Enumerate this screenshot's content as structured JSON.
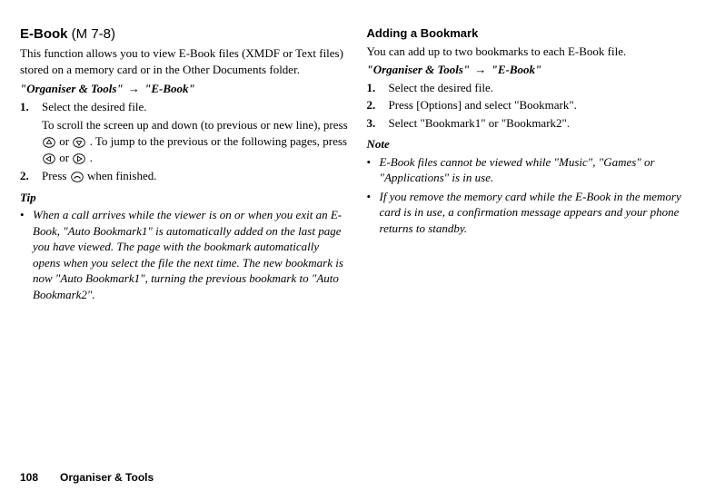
{
  "left": {
    "title_main": "E-Book ",
    "title_paren_open": "(",
    "title_menu_glyph": "M",
    "title_menu_num": " 7-8)",
    "intro": "This function allows you to view E-Book files (XMDF or Text files) stored on a memory card or in the Other Documents folder.",
    "path_a": "\"Organiser & Tools\"",
    "path_b": "\"E-Book\"",
    "step1_num": "1.",
    "step1_text": "Select the desired file.",
    "step1_sub_a": "To scroll the screen up and down (to previous or new line), press ",
    "step1_sub_b": " or ",
    "step1_sub_c": ". To jump to the previous or the following pages, press ",
    "step1_sub_d": " or ",
    "step1_sub_e": ".",
    "step2_num": "2.",
    "step2_a": "Press ",
    "step2_b": " when finished.",
    "tip_label": "Tip",
    "tip_bullet": "When a call arrives while the viewer is on or when you exit an E-Book, \"Auto Bookmark1\" is automatically added on the last page you have viewed. The page with the bookmark automatically opens when you select the file the next time. The new bookmark is now \"Auto Bookmark1\", turning the previous bookmark to \"Auto Bookmark2\"."
  },
  "right": {
    "subhead": "Adding a Bookmark",
    "intro": "You can add up to two bookmarks to each E-Book file.",
    "path_a": "\"Organiser & Tools\"",
    "path_b": "\"E-Book\"",
    "step1_num": "1.",
    "step1_text": "Select the desired file.",
    "step2_num": "2.",
    "step2_text": "Press [Options] and select \"Bookmark\".",
    "step3_num": "3.",
    "step3_text": "Select \"Bookmark1\" or \"Bookmark2\".",
    "note_label": "Note",
    "note1": "E-Book files cannot be viewed while \"Music\", \"Games\" or \"Applications\" is in use.",
    "note2": "If you remove the memory card while the E-Book in the memory card is in use, a confirmation message appears and your phone returns to standby."
  },
  "footer": {
    "page": "108",
    "section": "Organiser & Tools"
  }
}
